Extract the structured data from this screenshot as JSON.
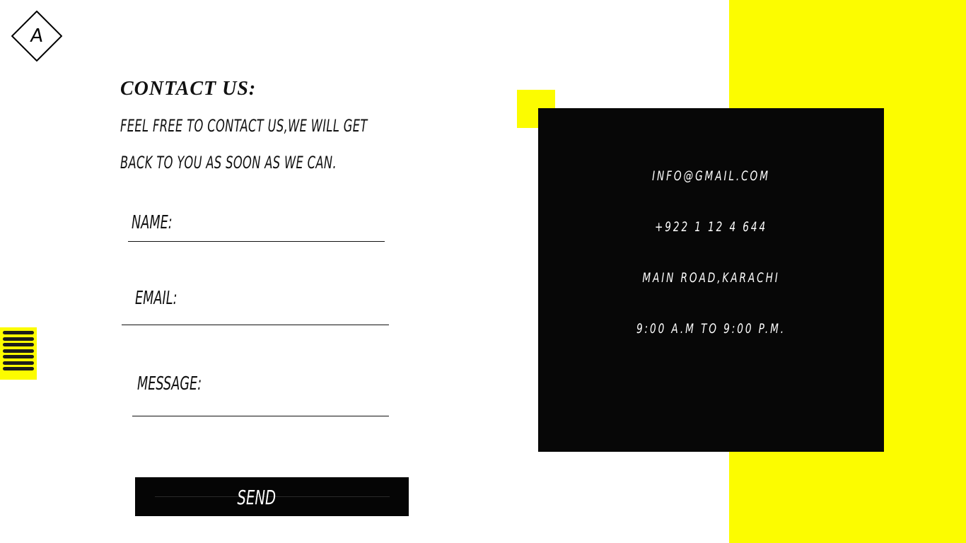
{
  "logo": {
    "letter": "A"
  },
  "colors": {
    "accent": "#fcfc00",
    "dark": "#070707",
    "background": "#ffffff"
  },
  "menu": {
    "icon": "hamburger-menu-icon"
  },
  "contact": {
    "heading": "CONTACT US:",
    "line1": "FEEL FREE TO CONTACT US,WE WILL GET",
    "line2": "BACK TO YOU AS SOON AS WE CAN."
  },
  "form": {
    "name_label": "NAME:",
    "email_label": "EMAIL:",
    "message_label": "MESSAGE:",
    "send_label": "SEND"
  },
  "info": {
    "email": "INFO@GMAIL.COM",
    "phone": "+922 1 12 4 644",
    "address": "MAIN ROAD,KARACHI",
    "hours": "9:00 A.M TO 9:00 P.M."
  }
}
